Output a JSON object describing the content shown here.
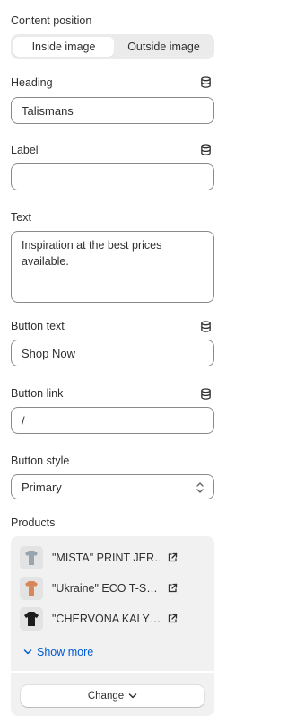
{
  "content_position": {
    "label": "Content position",
    "options": [
      "Inside image",
      "Outside image"
    ],
    "selected": "Inside image"
  },
  "heading": {
    "label": "Heading",
    "value": "Talismans",
    "icon": "database-icon"
  },
  "label_field": {
    "label": "Label",
    "value": "",
    "icon": "database-icon"
  },
  "text": {
    "label": "Text",
    "value": "Inspiration at the best prices available."
  },
  "button_text": {
    "label": "Button text",
    "value": "Shop Now",
    "icon": "database-icon"
  },
  "button_link": {
    "label": "Button link",
    "value": "/",
    "icon": "database-icon"
  },
  "button_style": {
    "label": "Button style",
    "value": "Primary"
  },
  "products": {
    "label": "Products",
    "items": [
      {
        "title": "\"MISTA\" PRINT JER…",
        "thumb_color": "#9aa4ad"
      },
      {
        "title": "\"Ukraine\" ECO T-S…",
        "thumb_color": "#d9875a"
      },
      {
        "title": "\"CHERVONA KALY…",
        "thumb_color": "#1c1c1c"
      }
    ],
    "show_more": "Show more",
    "change": "Change"
  },
  "colors": {
    "link": "#005bd3",
    "border": "#8a8a8a",
    "panel": "#f1f1f1"
  }
}
